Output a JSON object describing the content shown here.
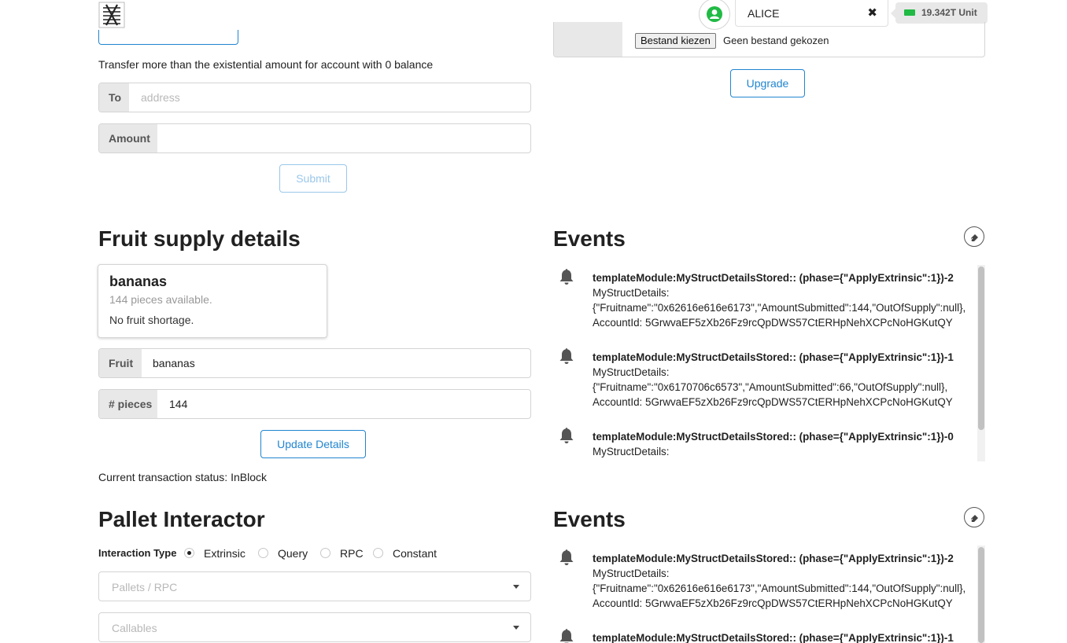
{
  "header": {
    "account_name": "ALICE",
    "clear_glyph": "✖",
    "balance": "19.342T Unit"
  },
  "upgrade_panel": {
    "file_button": "Bestand kiezen",
    "file_status": "Geen bestand gekozen",
    "upgrade_label": "Upgrade"
  },
  "transfer": {
    "description": "Transfer more than the existential amount for account with 0 balance",
    "to_label": "To",
    "to_placeholder": "address",
    "amount_label": "Amount",
    "amount_value": "",
    "submit_label": "Submit"
  },
  "fruit": {
    "title": "Fruit supply details",
    "card_name": "bananas",
    "card_meta": "144 pieces available.",
    "card_desc": "No fruit shortage.",
    "fruit_label": "Fruit",
    "fruit_value": "bananas",
    "pieces_label": "# pieces",
    "pieces_value": "144",
    "update_label": "Update Details",
    "status": "Current transaction status: InBlock"
  },
  "events_1": {
    "title": "Events",
    "items": [
      {
        "title": "templateModule:MyStructDetailsStored:: (phase={\"ApplyExtrinsic\":1})-2",
        "line1": "MyStructDetails:",
        "line2": "{\"Fruitname\":\"0x62616e616e6173\",\"AmountSubmitted\":144,\"OutOfSupply\":null},",
        "line3": "AccountId: 5GrwvaEF5zXb26Fz9rcQpDWS57CtERHpNehXCPcNoHGKutQY"
      },
      {
        "title": "templateModule:MyStructDetailsStored:: (phase={\"ApplyExtrinsic\":1})-1",
        "line1": "MyStructDetails:",
        "line2": "{\"Fruitname\":\"0x6170706c6573\",\"AmountSubmitted\":66,\"OutOfSupply\":null},",
        "line3": "AccountId: 5GrwvaEF5zXb26Fz9rcQpDWS57CtERHpNehXCPcNoHGKutQY"
      },
      {
        "title": "templateModule:MyStructDetailsStored:: (phase={\"ApplyExtrinsic\":1})-0",
        "line1": "MyStructDetails:"
      }
    ]
  },
  "pallet": {
    "title": "Pallet Interactor",
    "interaction_label": "Interaction Type",
    "options": [
      "Extrinsic",
      "Query",
      "RPC",
      "Constant"
    ],
    "selected": "Extrinsic",
    "pallets_placeholder": "Pallets / RPC",
    "callables_placeholder": "Callables"
  },
  "events_2": {
    "title": "Events",
    "items": [
      {
        "title": "templateModule:MyStructDetailsStored:: (phase={\"ApplyExtrinsic\":1})-2",
        "line1": "MyStructDetails:",
        "line2": "{\"Fruitname\":\"0x62616e616e6173\",\"AmountSubmitted\":144,\"OutOfSupply\":null},",
        "line3": "AccountId: 5GrwvaEF5zXb26Fz9rcQpDWS57CtERHpNehXCPcNoHGKutQY"
      },
      {
        "title": "templateModule:MyStructDetailsStored:: (phase={\"ApplyExtrinsic\":1})-1"
      }
    ]
  },
  "colors": {
    "accent": "#2185d0",
    "balance_green": "#21ba45",
    "avatar_green": "#21ba45"
  }
}
